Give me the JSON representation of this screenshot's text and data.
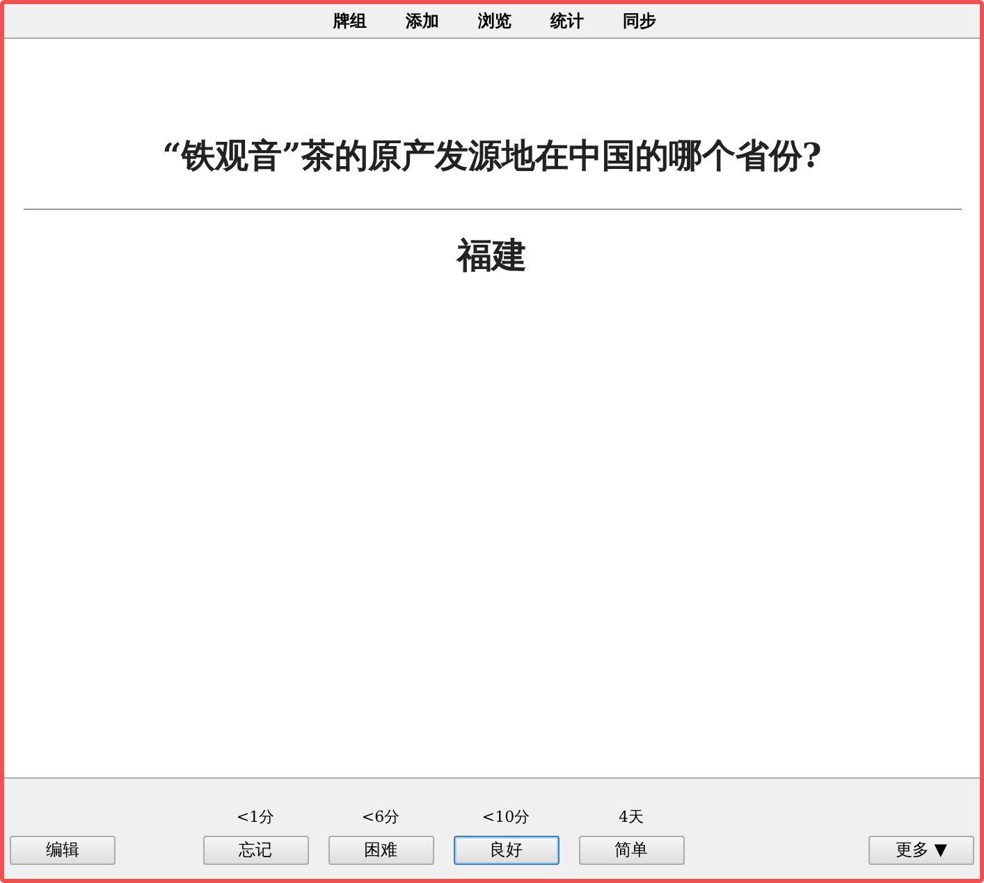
{
  "top_menu": [
    {
      "label": "牌组"
    },
    {
      "label": "添加"
    },
    {
      "label": "浏览"
    },
    {
      "label": "统计"
    },
    {
      "label": "同步"
    }
  ],
  "card": {
    "question": "“铁观音”茶的原产发源地在中国的哪个省份?",
    "answer": "福建"
  },
  "bottom_bar": {
    "edit_button": "编辑",
    "answer_buttons": [
      {
        "interval": "<1分",
        "label": "忘记",
        "selected": false
      },
      {
        "interval": "<6分",
        "label": "困难",
        "selected": false
      },
      {
        "interval": "<10分",
        "label": "良好",
        "selected": true
      },
      {
        "interval": "4天",
        "label": "简单",
        "selected": false
      }
    ],
    "more_button": "更多 ▼"
  }
}
